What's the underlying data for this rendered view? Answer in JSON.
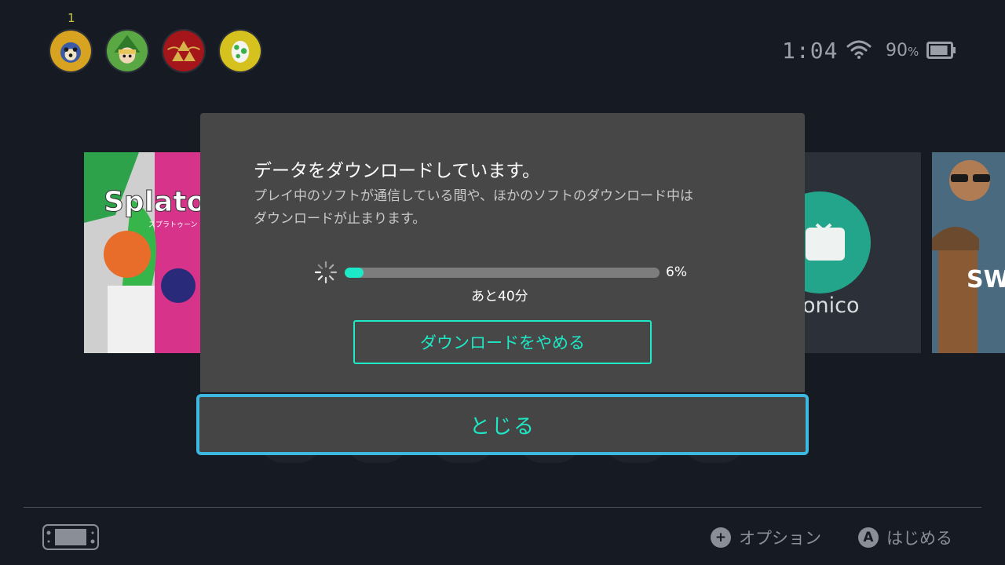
{
  "status_bar": {
    "user_count": "1",
    "time": "1:04",
    "battery_percent_value": "90",
    "battery_percent_unit": "%",
    "battery_level": 0.9
  },
  "users": [
    {
      "name": "user-avatar-1",
      "color": "#d8a321"
    },
    {
      "name": "user-avatar-2",
      "color": "#4f9e3a"
    },
    {
      "name": "user-avatar-3",
      "color": "#a5161b"
    },
    {
      "name": "user-avatar-4",
      "color": "#d6c21f"
    }
  ],
  "tiles": {
    "splatoon_title": "Splato",
    "splatoon_subtitle": "スプラトゥーン",
    "niconico_label": "onico",
    "sw_label": "SW"
  },
  "modal": {
    "title": "データをダウンロードしています。",
    "description": "プレイ中のソフトが通信している間や、ほかのソフトのダウンロード中は\nダウンロードが止まります。",
    "progress_value": 6,
    "progress_label": "6%",
    "remaining_time": "あと40分",
    "stop_button_label": "ダウンロードをやめる",
    "close_button_label": "とじる",
    "accent_color": "#1de9c6",
    "focus_color": "#3db8e0"
  },
  "footer": {
    "options_glyph": "+",
    "options_label": "オプション",
    "start_glyph": "A",
    "start_label": "はじめる"
  }
}
